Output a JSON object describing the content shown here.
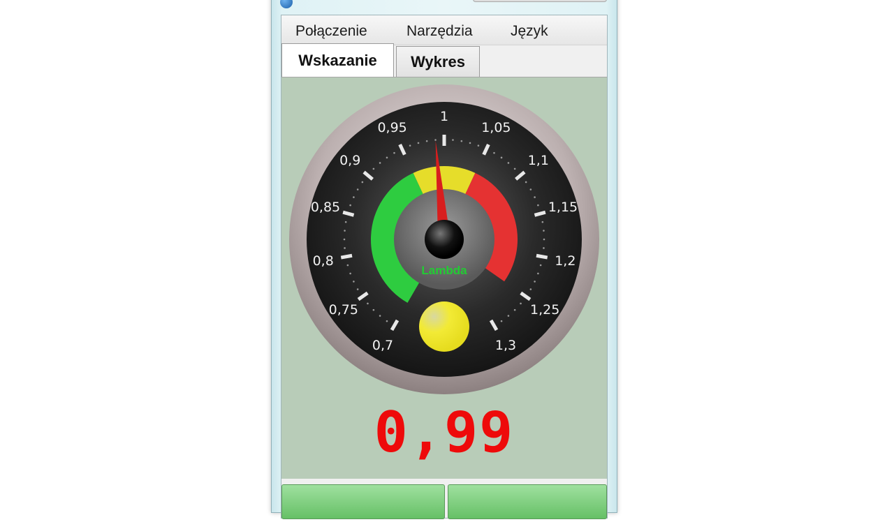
{
  "window": {
    "title": "",
    "icon": "app-icon"
  },
  "menu": {
    "items": [
      "Połączenie",
      "Narzędzia",
      "Język"
    ]
  },
  "tabs": [
    {
      "label": "Wskazanie",
      "active": true
    },
    {
      "label": "Wykres",
      "active": false
    }
  ],
  "gauge": {
    "ticks": [
      "0,7",
      "0,75",
      "0,8",
      "0,85",
      "0,9",
      "0,95",
      "1",
      "1,05",
      "1,1",
      "1,15",
      "1,2",
      "1,25",
      "1,3"
    ],
    "min": 0.7,
    "max": 1.3,
    "value": 0.99,
    "caption": "Lambda",
    "colors": {
      "green": "#2ecc40",
      "yellow": "#e6dd2a",
      "red": "#e53232",
      "needle": "#d81e1e",
      "indicator": "#f2e52c"
    },
    "zones": [
      {
        "color": "green",
        "from": 0.7,
        "to": 0.95
      },
      {
        "color": "yellow",
        "from": 0.95,
        "to": 1.05
      },
      {
        "color": "red",
        "from": 1.05,
        "to": 1.25
      }
    ]
  },
  "readout": {
    "value": "0,99",
    "color": "#ee0a0a"
  }
}
